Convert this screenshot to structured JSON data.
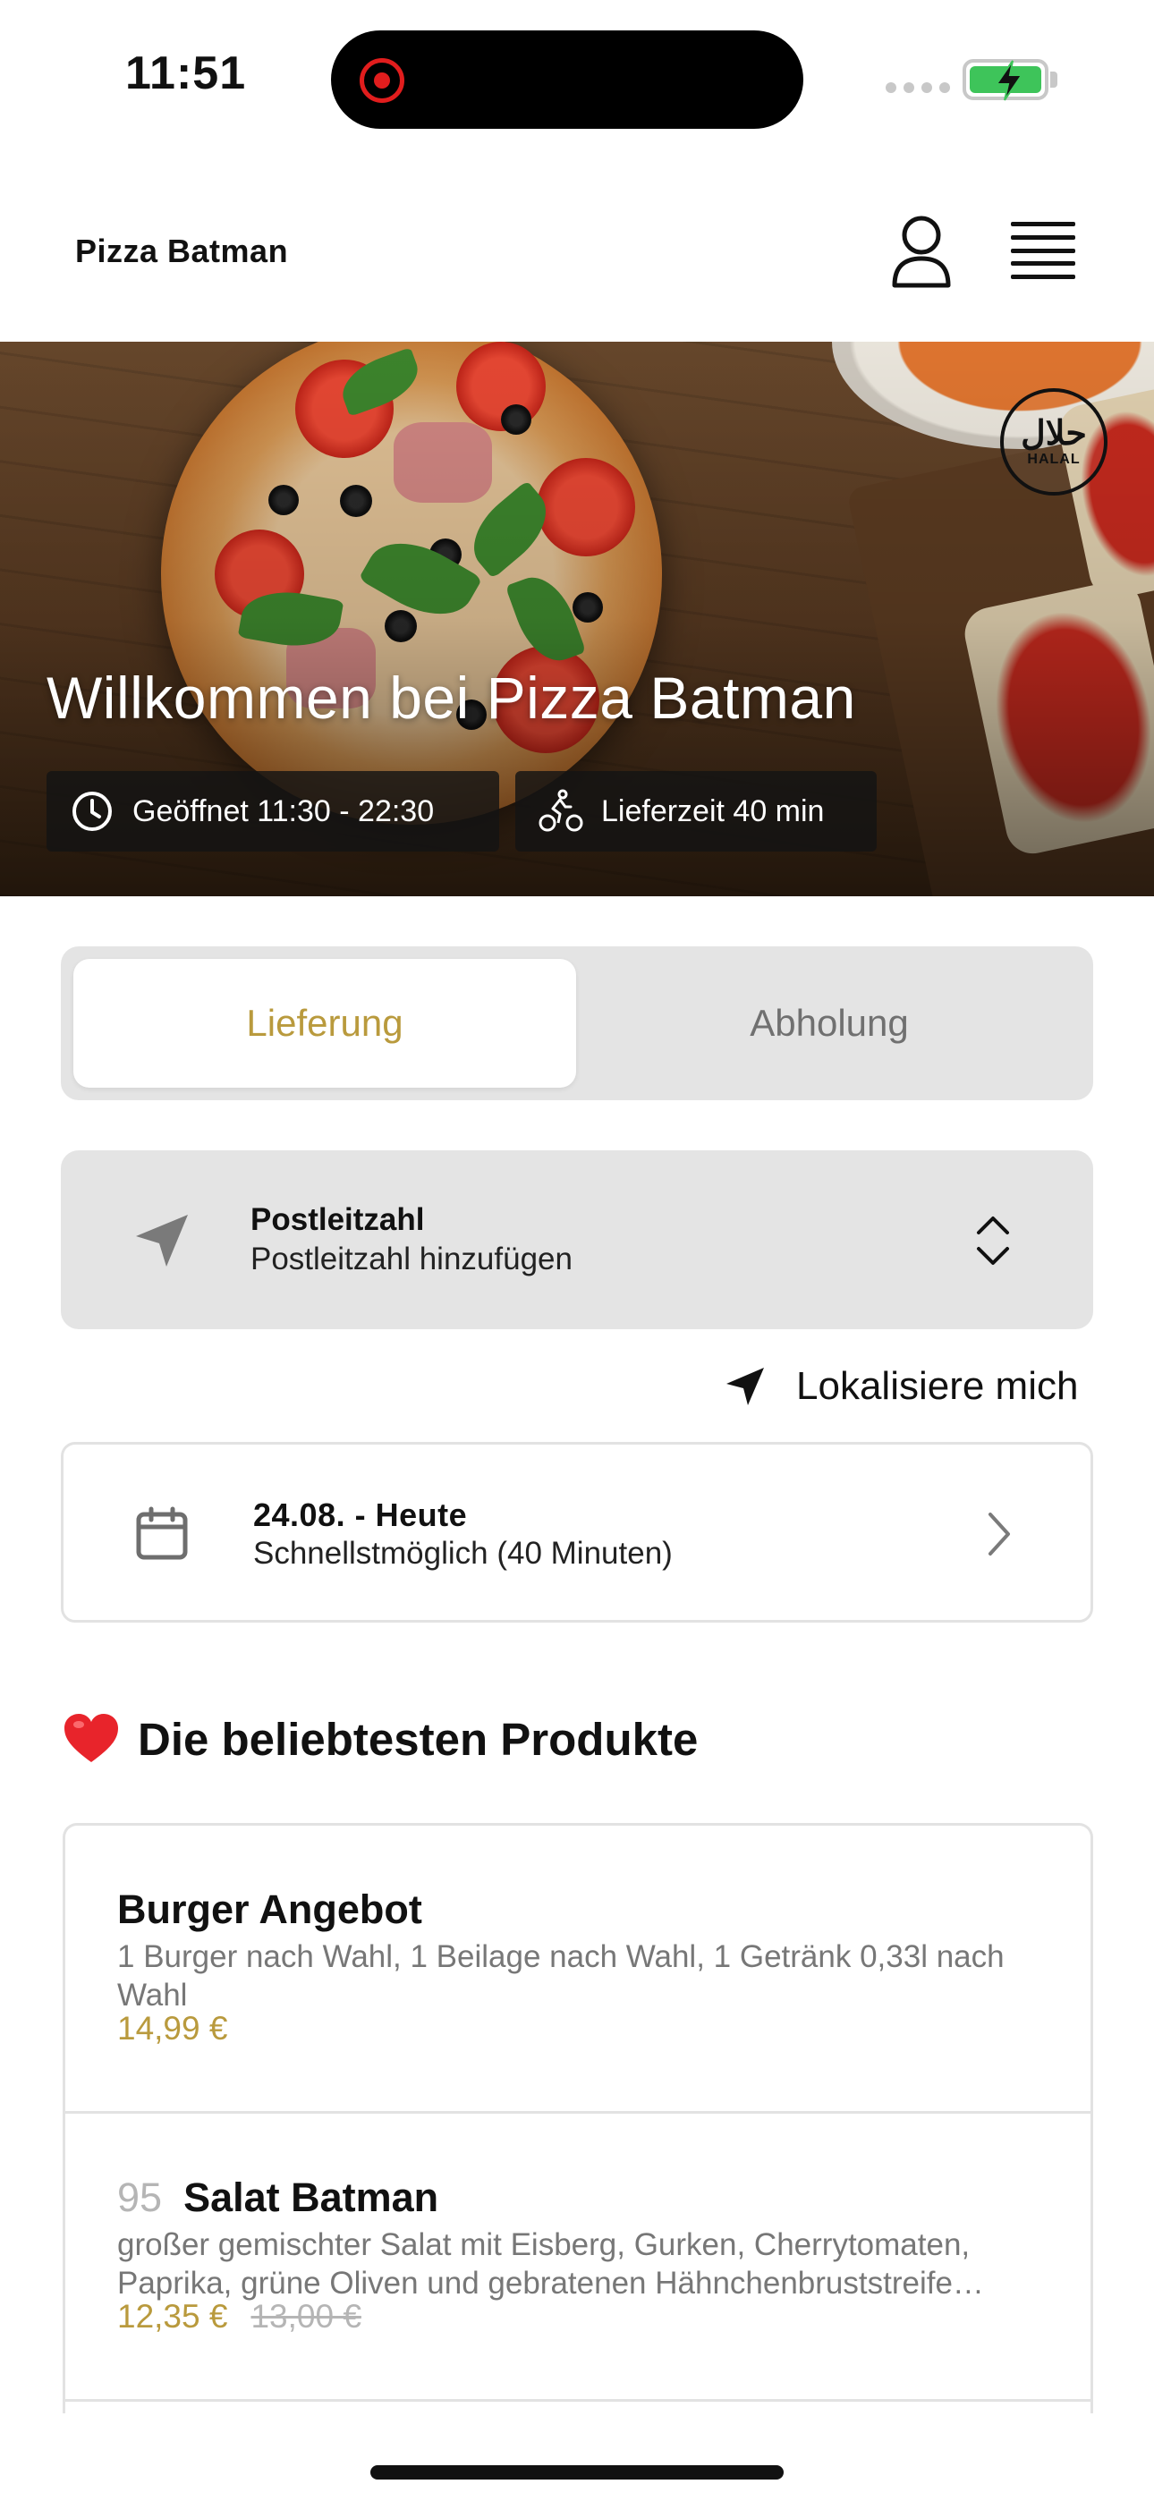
{
  "status_bar": {
    "time": "11:51"
  },
  "header": {
    "title": "Pizza Batman"
  },
  "hero": {
    "badge_arabic": "حلال",
    "badge_label": "HALAL",
    "title": "Willkommen bei Pizza Batman",
    "opening_hours": "Geöffnet 11:30 - 22:30",
    "delivery_time": "Lieferzeit 40 min"
  },
  "order_mode": {
    "options": [
      "Lieferung",
      "Abholung"
    ],
    "selected": "Lieferung"
  },
  "postcode": {
    "label": "Postleitzahl",
    "value": "Postleitzahl hinzufügen"
  },
  "locate": {
    "label": "Lokalisiere mich"
  },
  "schedule": {
    "date": "24.08. - Heute",
    "time": "Schnellstmöglich (40 Minuten)"
  },
  "popular": {
    "title": "Die beliebtesten Produkte",
    "products": [
      {
        "number": "",
        "name": "Burger Angebot",
        "description": "1 Burger nach Wahl, 1 Beilage nach Wahl, 1 Getränk 0,33l nach Wahl",
        "price": "14,99 €",
        "old_price": ""
      },
      {
        "number": "95",
        "name": "Salat Batman",
        "description": "großer gemischter Salat mit Eisberg, Gurken, Cherrytomaten, Paprika, grüne Oliven und gebratenen Hähnchenbruststreife…",
        "price": "12,35 €",
        "old_price": "13,00 €"
      }
    ]
  },
  "colors": {
    "accent": "#b99a3d",
    "panel": "#e4e4e4",
    "battery": "#3ec45a",
    "recording": "#e11d1d"
  },
  "icons": {
    "user": "user-icon",
    "menu": "hamburger-menu-icon",
    "clock": "clock-icon",
    "delivery": "bicycle-courier-icon",
    "location": "location-arrow-icon",
    "stepper": "chevron-up-down-icon",
    "calendar": "calendar-icon",
    "chevron": "chevron-right-icon",
    "heart": "heart-icon"
  }
}
